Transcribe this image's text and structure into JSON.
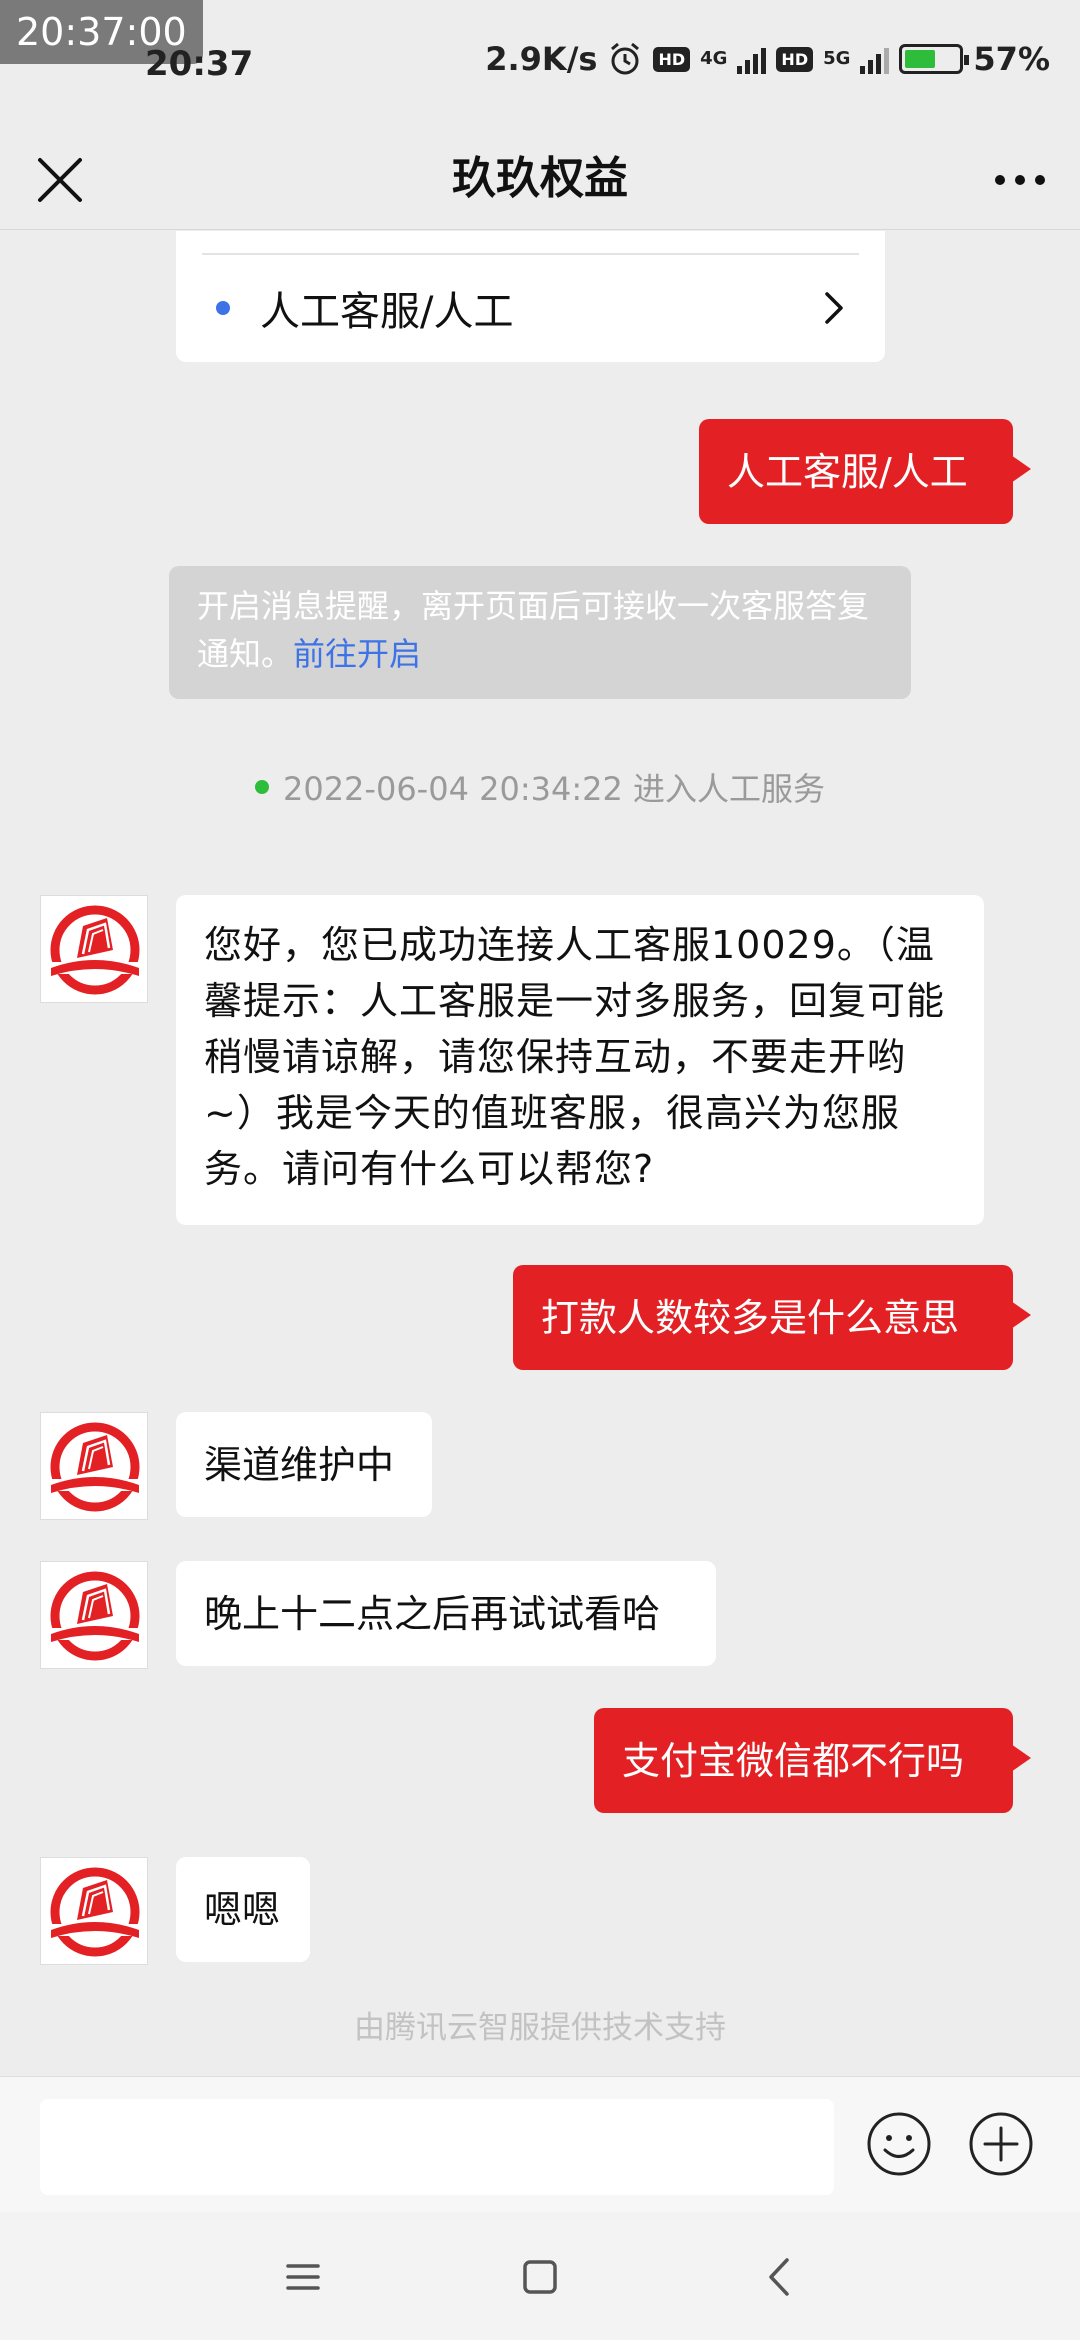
{
  "status_bar": {
    "overlay_clock": "20:37:00",
    "time": "20:37",
    "net_speed": "2.9K/s",
    "hd_badge": "HD",
    "sim1_type": "4G",
    "sim2_type": "5G",
    "battery": "57%",
    "battery_level": 0.57
  },
  "nav": {
    "title": "玖玖权益",
    "close_icon": "close-icon",
    "more_icon": "more-icon"
  },
  "menu_card": {
    "item_label": "人工客服/人工"
  },
  "notice": {
    "text": "开启消息提醒，离开页面后可接收一次客服答复通知。",
    "link": "前往开启"
  },
  "timeline": {
    "text": "2022-06-04 20:34:22 进入人工服务"
  },
  "messages": [
    {
      "sender": "me",
      "text": "人工客服/人工"
    },
    {
      "sender": "them",
      "text": "您好，您已成功连接人工客服10029。（温馨提示：人工客服是一对多服务，回复可能稍慢请谅解，请您保持互动，不要走开哟~）我是今天的值班客服，很高兴为您服务。请问有什么可以帮您?"
    },
    {
      "sender": "me",
      "text": "打款人数较多是什么意思"
    },
    {
      "sender": "them",
      "text": "渠道维护中"
    },
    {
      "sender": "them",
      "text": "晚上十二点之后再试试看哈"
    },
    {
      "sender": "me",
      "text": "支付宝微信都不行吗"
    },
    {
      "sender": "them",
      "text": "嗯嗯"
    }
  ],
  "powered_by": "由腾讯云智服提供技术支持",
  "input": {
    "placeholder": ""
  },
  "colors": {
    "accent_red": "#e32124",
    "link_blue": "#3d73e6",
    "online_green": "#2ebd3a",
    "background": "#ededed"
  }
}
